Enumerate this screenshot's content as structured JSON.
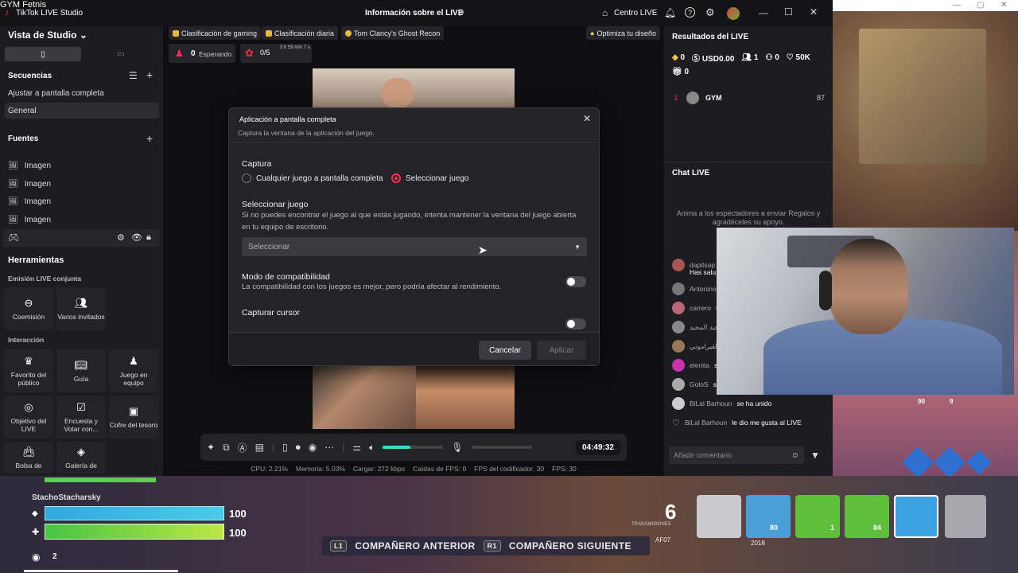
{
  "overlay_label": "GYM Fetnis",
  "app": {
    "title": "TikTok LIVE Studio",
    "center_title": "Información sobre el LIVE",
    "live_center": "Centro LIVE"
  },
  "left": {
    "studio_view": "Vista de Studio",
    "sequences": "Secuencias",
    "seq_items": [
      "Ajustar a pantalla completa",
      "General"
    ],
    "sources": "Fuentes",
    "source_items": [
      "Imagen",
      "Imagen",
      "Imagen",
      "Imagen",
      "Imagen"
    ],
    "tools": "Herramientas",
    "joint_live": "Emisión LIVE conjunta",
    "tools_joint": [
      "Coemisión",
      "Varios invitados"
    ],
    "interaction": "Interacción",
    "tools_interaction": [
      "Favorito del público",
      "Guía",
      "Juego en equipo",
      "Objetivo del LIVE",
      "Encuesta y Votar con...",
      "Cofre del tesoro",
      "Bolsa de",
      "Galería de"
    ]
  },
  "chips": [
    "Clasificación de gaming",
    "Clasificación diaria",
    "Tom Clancy's Ghost Recon",
    "Optimiza tu diseño"
  ],
  "waiting": {
    "count": "0",
    "label": "Esperando"
  },
  "goal": {
    "progress": "0/5",
    "timer": "3 h 59 min 7 s"
  },
  "modal": {
    "title": "Aplicación a pantalla completa",
    "subtitle": "Captura la ventana de la aplicación del juego.",
    "capture": "Captura",
    "opt_any": "Cualquier juego a pantalla completa",
    "opt_select": "Seleccionar juego",
    "select_game": "Seleccionar juego",
    "select_desc1": "Si no puedes encontrar el juego al que estás jugando, intenta mantener la ventana del juego abierta",
    "select_desc2": "en tu equipo de escritorio.",
    "select_placeholder": "Seleccionar",
    "compat": "Modo de compatibilidad",
    "compat_desc": "La compatibilidad con los juegos es mejor, pero podría afectar al rendimiento.",
    "cursor": "Capturar cursor",
    "cancel": "Cancelar",
    "apply": "Aplicar"
  },
  "controls": {
    "time": "04:49:32",
    "volume_level": 0.45
  },
  "status": [
    "CPU: 2.21%",
    "Memoria: 5.03%",
    "Cargar: 272 kbps",
    "Caídas de FPS: 0",
    "FPS del codificador: 30",
    "FPS: 30"
  ],
  "right": {
    "results": "Resultados del LIVE",
    "stats": [
      "0",
      "USD0.00",
      "1",
      "0",
      "50K"
    ],
    "gifts": "0",
    "rank": {
      "pos": "1",
      "name": "GYM",
      "score": "87"
    },
    "chat": "Chat LIVE",
    "chat_hint": "Anima a los espectadores a enviar Regalos y agradéceles su apoyo.",
    "messages": [
      {
        "user": "dapitsap",
        "text": "Has salu"
      },
      {
        "user": "Antonino",
        "text": ""
      },
      {
        "user": "carrero",
        "text": "se"
      },
      {
        "user": "عبد المجيد",
        "text": "s"
      },
      {
        "user": "بن القيراموني",
        "text": ""
      },
      {
        "user": "elenita",
        "text": "se"
      },
      {
        "user": "GoloS",
        "text": "se"
      },
      {
        "user": "BiLal Barhoun",
        "text": "se ha unido"
      },
      {
        "user": "BiLal Barhoun",
        "text": "le dio me gusta al LIVE"
      }
    ],
    "comment_placeholder": "Añadir comentario"
  },
  "hud": {
    "player": "StachoStacharsky",
    "health": "100",
    "shield": "100",
    "count": "6",
    "count_label": "TRANSMISIONES",
    "ammo": [
      "80",
      "1",
      "84"
    ],
    "prev": "COMPAÑERO ANTERIOR",
    "next": "COMPAÑERO SIGUIENTE",
    "prev_key": "L1",
    "next_key": "R1",
    "cam_tags": [
      "AF07",
      "2018"
    ],
    "slot_badges": [
      "90",
      "9"
    ],
    "eye_count": "2"
  },
  "colors": {
    "accent": "#fe2c55",
    "bg": "#17171b",
    "panel": "#1c1c21"
  }
}
